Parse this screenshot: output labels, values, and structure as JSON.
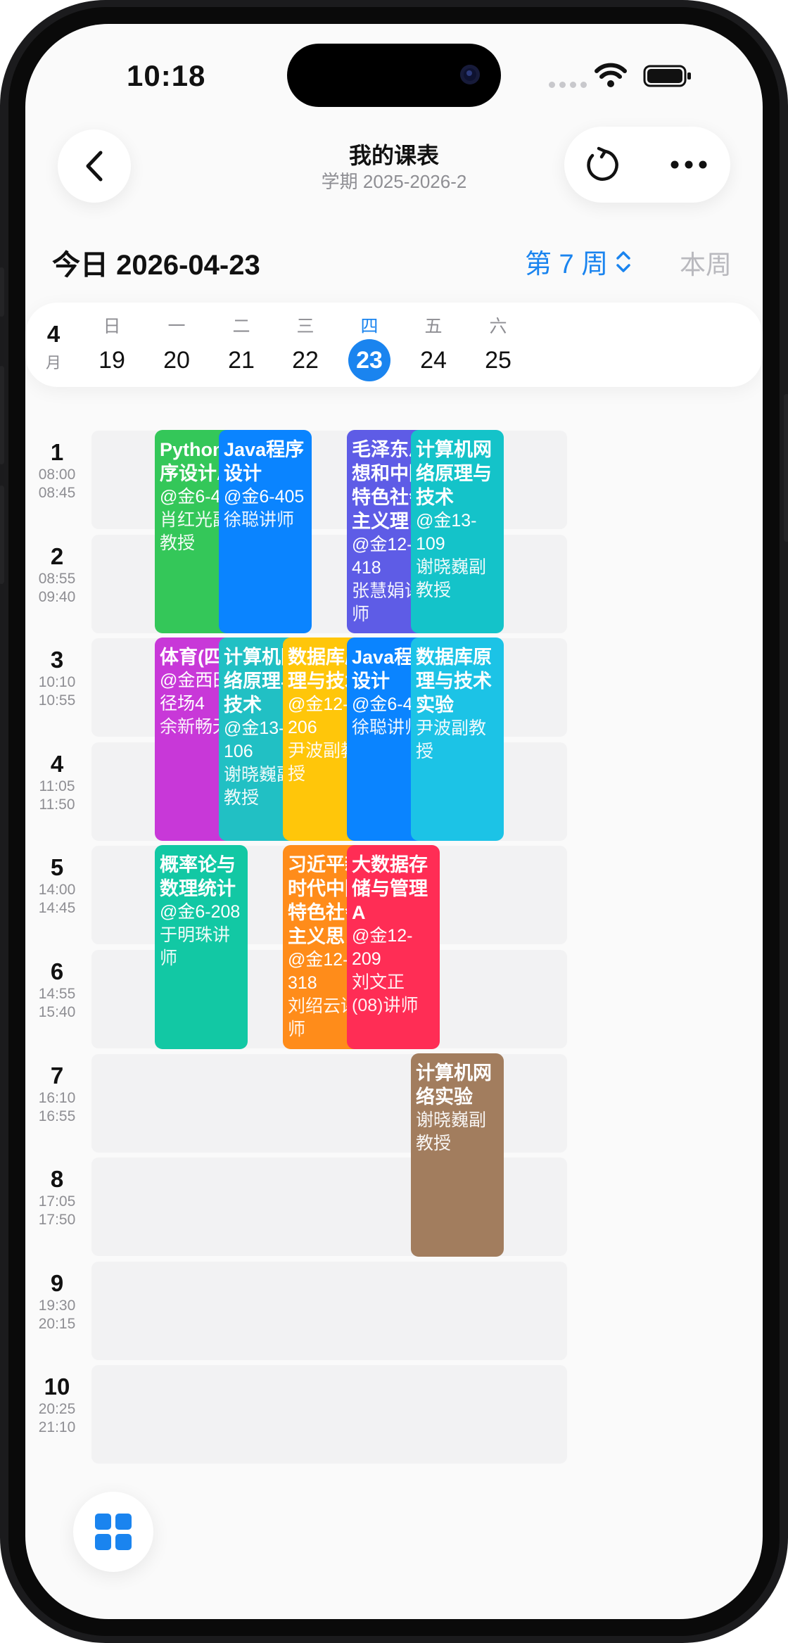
{
  "status": {
    "time": "10:18"
  },
  "header": {
    "title": "我的课表",
    "subtitle": "学期 2025-2026-2"
  },
  "today_label": "今日 2026-04-23",
  "week_selector": {
    "label": "第 7 周",
    "icon": "chevron-up-down-icon"
  },
  "this_week_label": "本周",
  "month": {
    "number": "4",
    "unit": "月"
  },
  "days": [
    {
      "weekday": "日",
      "date": "19",
      "active": false
    },
    {
      "weekday": "一",
      "date": "20",
      "active": false
    },
    {
      "weekday": "二",
      "date": "21",
      "active": false
    },
    {
      "weekday": "三",
      "date": "22",
      "active": false
    },
    {
      "weekday": "四",
      "date": "23",
      "active": true
    },
    {
      "weekday": "五",
      "date": "24",
      "active": false
    },
    {
      "weekday": "六",
      "date": "25",
      "active": false
    }
  ],
  "periods": [
    {
      "num": "1",
      "start": "08:00",
      "end": "08:45"
    },
    {
      "num": "2",
      "start": "08:55",
      "end": "09:40"
    },
    {
      "num": "3",
      "start": "10:10",
      "end": "10:55"
    },
    {
      "num": "4",
      "start": "11:05",
      "end": "11:50"
    },
    {
      "num": "5",
      "start": "14:00",
      "end": "14:45"
    },
    {
      "num": "6",
      "start": "14:55",
      "end": "15:40"
    },
    {
      "num": "7",
      "start": "16:10",
      "end": "16:55"
    },
    {
      "num": "8",
      "start": "17:05",
      "end": "17:50"
    },
    {
      "num": "9",
      "start": "19:30",
      "end": "20:15"
    },
    {
      "num": "10",
      "start": "20:25",
      "end": "21:10"
    }
  ],
  "courses": [
    {
      "name": "Python程序设计A",
      "room": "@金6-405",
      "teacher": "肖红光副教授",
      "day": 1,
      "start": 1,
      "span": 2,
      "color": "#34c759"
    },
    {
      "name": "Java程序设计",
      "room": "@金6-405",
      "teacher": "徐聪讲师",
      "day": 2,
      "start": 1,
      "span": 2,
      "color": "#0a84ff"
    },
    {
      "name": "毛泽东思想和中国特色社会主义理…",
      "room": "@金12-418",
      "teacher": "张慧娟讲师",
      "day": 4,
      "start": 1,
      "span": 2,
      "color": "#5e5ce6"
    },
    {
      "name": "计算机网络原理与技术",
      "room": "@金13-109",
      "teacher": "谢晓巍副教授",
      "day": 5,
      "start": 1,
      "span": 2,
      "color": "#14c3c9"
    },
    {
      "name": "体育(四)",
      "room": "@金西田径场4",
      "teacher": "余新畅无",
      "day": 1,
      "start": 3,
      "span": 2,
      "color": "#c838d8"
    },
    {
      "name": "计算机网络原理与技术",
      "room": "@金13-106",
      "teacher": "谢晓巍副教授",
      "day": 2,
      "start": 3,
      "span": 2,
      "color": "#21c0c4"
    },
    {
      "name": "数据库原理与技术",
      "room": "@金12-206",
      "teacher": "尹波副教授",
      "day": 3,
      "start": 3,
      "span": 2,
      "color": "#ffc60a"
    },
    {
      "name": "Java程序设计",
      "room": "@金6-405",
      "teacher": "徐聪讲师",
      "day": 4,
      "start": 3,
      "span": 2,
      "color": "#0a84ff"
    },
    {
      "name": "数据库原理与技术实验",
      "room": "",
      "teacher": "尹波副教授",
      "day": 5,
      "start": 3,
      "span": 2,
      "color": "#1cc3e6"
    },
    {
      "name": "概率论与数理统计",
      "room": "@金6-208",
      "teacher": "于明珠讲师",
      "day": 1,
      "start": 5,
      "span": 2,
      "color": "#12c8a4"
    },
    {
      "name": "习近平新时代中国特色社会主义思…",
      "room": "@金12-318",
      "teacher": "刘绍云讲师",
      "day": 3,
      "start": 5,
      "span": 2,
      "color": "#ff8c1a"
    },
    {
      "name": "大数据存储与管理A",
      "room": "@金12-209",
      "teacher": "刘文正(08)讲师",
      "day": 4,
      "start": 5,
      "span": 2,
      "color": "#ff2d55"
    },
    {
      "name": "计算机网络实验",
      "room": "",
      "teacher": "谢晓巍副教授",
      "day": 5,
      "start": 7,
      "span": 2,
      "color": "#a27d5e"
    }
  ],
  "bottom": {
    "button_icon": "grid-icon"
  }
}
